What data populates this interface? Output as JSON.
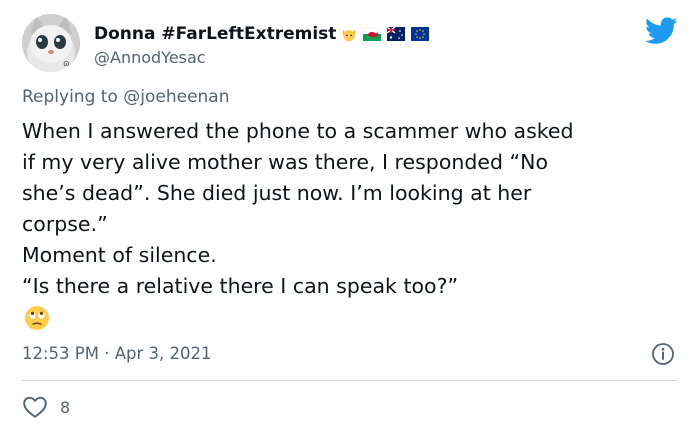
{
  "user": {
    "display_name": "Donna #FarLeftExtremist",
    "handle": "@AnnodYesac",
    "name_emojis": [
      "cat-face-icon",
      "wales-flag-icon",
      "australia-flag-icon",
      "eu-flag-icon"
    ]
  },
  "reply": {
    "prefix": "Replying to",
    "mention": "@joeheenan"
  },
  "tweet": {
    "lines": [
      "When I answered the phone to a scammer who asked",
      "if my very alive mother was there, I responded “No",
      "she’s dead”. She died just now. I’m looking at her",
      "corpse.”",
      "Moment of silence.",
      "“Is there a relative there I can speak too?”"
    ],
    "emoji": "face-with-rolling-eyes-icon"
  },
  "meta": {
    "timestamp": "12:53 PM · Apr 3, 2021"
  },
  "engagement": {
    "likes": "8"
  },
  "colors": {
    "text": "#0f1419",
    "secondary": "#536471",
    "twitter_blue": "#1d9bf0",
    "divider": "#cfd9de"
  }
}
